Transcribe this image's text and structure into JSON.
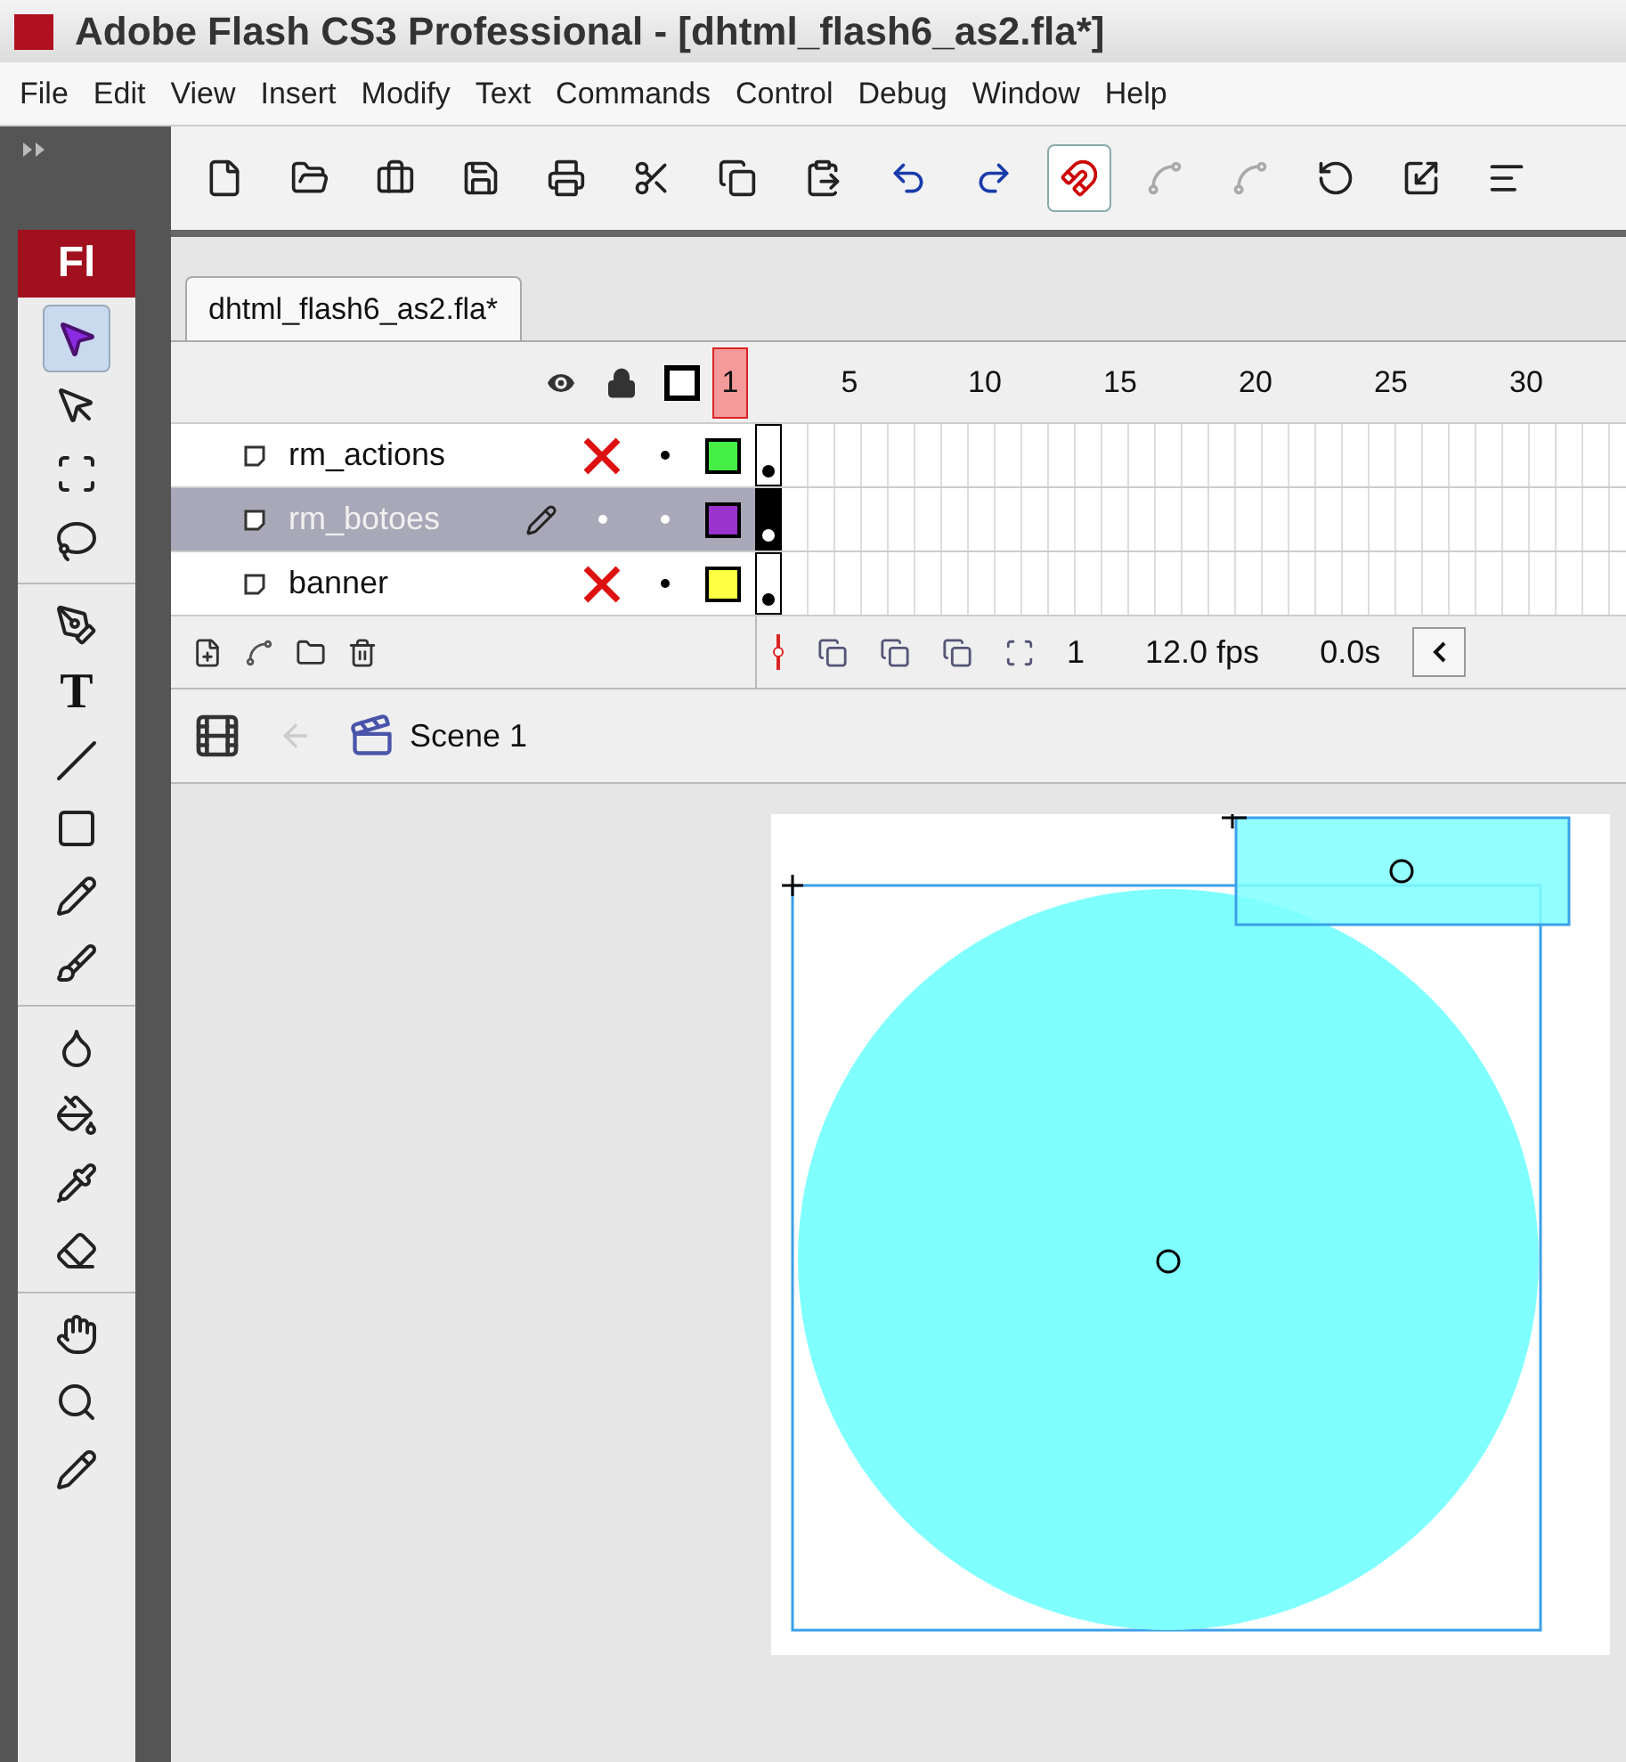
{
  "window": {
    "title": "Adobe Flash CS3 Professional - [dhtml_flash6_as2.fla*]"
  },
  "menu": [
    "File",
    "Edit",
    "View",
    "Insert",
    "Modify",
    "Text",
    "Commands",
    "Control",
    "Debug",
    "Window",
    "Help"
  ],
  "toolbar": [
    {
      "kind": "new",
      "on": false,
      "disabled": false
    },
    {
      "kind": "open",
      "on": false,
      "disabled": false
    },
    {
      "kind": "bridge",
      "on": false,
      "disabled": false
    },
    {
      "kind": "save",
      "on": false,
      "disabled": false
    },
    {
      "kind": "print",
      "on": false,
      "disabled": false
    },
    {
      "kind": "cut",
      "on": false,
      "disabled": false
    },
    {
      "kind": "copy",
      "on": false,
      "disabled": false
    },
    {
      "kind": "paste",
      "on": false,
      "disabled": false
    },
    {
      "kind": "undo",
      "on": false,
      "disabled": false
    },
    {
      "kind": "redo",
      "on": false,
      "disabled": false
    },
    {
      "kind": "snap",
      "on": true,
      "disabled": false
    },
    {
      "kind": "smooth",
      "on": false,
      "disabled": true
    },
    {
      "kind": "straighten",
      "on": false,
      "disabled": true
    },
    {
      "kind": "rotate",
      "on": false,
      "disabled": false
    },
    {
      "kind": "scale",
      "on": false,
      "disabled": false
    },
    {
      "kind": "align",
      "on": false,
      "disabled": false
    }
  ],
  "logo": "Fl",
  "tool_groups": [
    [
      {
        "kind": "selection",
        "selected": true
      },
      {
        "kind": "subselection",
        "selected": false
      },
      {
        "kind": "transform",
        "selected": false
      },
      {
        "kind": "lasso",
        "selected": false
      }
    ],
    [
      {
        "kind": "pen",
        "selected": false
      },
      {
        "kind": "text",
        "label": "T",
        "selected": false
      },
      {
        "kind": "line",
        "selected": false
      },
      {
        "kind": "rectangle",
        "selected": false
      },
      {
        "kind": "pencil",
        "selected": false
      },
      {
        "kind": "brush",
        "selected": false
      }
    ],
    [
      {
        "kind": "inkbottle",
        "selected": false
      },
      {
        "kind": "bucket",
        "selected": false
      },
      {
        "kind": "eyedropper",
        "selected": false
      },
      {
        "kind": "eraser",
        "selected": false
      }
    ],
    [
      {
        "kind": "hand",
        "selected": false
      },
      {
        "kind": "zoom",
        "selected": false
      },
      {
        "kind": "stroke",
        "selected": false
      }
    ]
  ],
  "document_tab": {
    "label": "dhtml_flash6_as2.fla*",
    "selected": true
  },
  "timeline": {
    "frame_numbers": [
      {
        "label": "1",
        "selected": true
      },
      {
        "label": "5",
        "selected": false
      },
      {
        "label": "10",
        "selected": false
      },
      {
        "label": "15",
        "selected": false
      },
      {
        "label": "20",
        "selected": false
      },
      {
        "label": "25",
        "selected": false
      },
      {
        "label": "30",
        "selected": false
      }
    ],
    "layers": [
      {
        "name": "rm_actions",
        "selected": false,
        "hidden": true,
        "color": "#44ee44"
      },
      {
        "name": "rm_botoes",
        "selected": true,
        "hidden": false,
        "color": "#9933cc"
      },
      {
        "name": "banner",
        "selected": false,
        "hidden": true,
        "color": "#ffff44"
      }
    ],
    "current_frame": "1",
    "frame_rate": "12.0 fps",
    "elapsed": "0.0s"
  },
  "breadcrumb": {
    "scene": "Scene 1"
  }
}
